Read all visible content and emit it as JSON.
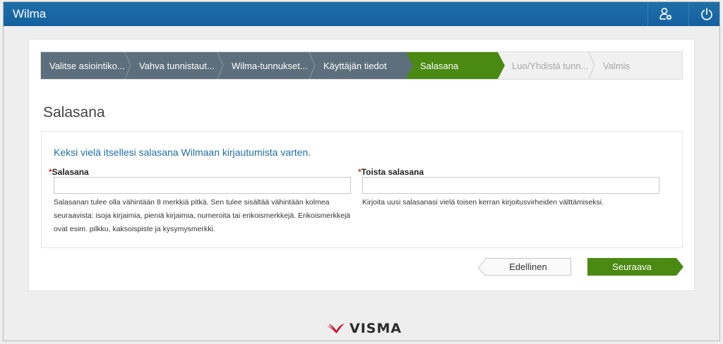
{
  "app": {
    "title": "Wilma"
  },
  "header": {
    "user_icon": "user-settings-icon",
    "power_icon": "power-icon"
  },
  "steps": [
    {
      "label": "Valitse asiointiko...",
      "state": "done"
    },
    {
      "label": "Vahva tunnistaut...",
      "state": "done"
    },
    {
      "label": "Wilma-tunnukset...",
      "state": "done"
    },
    {
      "label": "Käyttäjän tiedot",
      "state": "done"
    },
    {
      "label": "Salasana",
      "state": "active"
    },
    {
      "label": "Luo/Yhdistä tunn...",
      "state": "todo"
    },
    {
      "label": "Valmis",
      "state": "todo"
    }
  ],
  "page": {
    "title": "Salasana"
  },
  "form": {
    "intro": "Keksi vielä itsellesi salasana Wilmaan kirjautumista varten.",
    "required_mark": "*",
    "password": {
      "label": "Salasana",
      "value": "",
      "help_lines": [
        "Salasanan tulee olla vähintään 8 merkkiä pitkä. Sen tulee sisältää vähintään kolmea",
        "seuraavista: isoja kirjaimia, pieniä kirjaimia, numeroita tai erikoismerkkejä. Erikoismerkkejä",
        "ovat esim. pilkku, kaksoispiste ja kysymysmerkki."
      ]
    },
    "repeat": {
      "label": "Toista salasana",
      "value": "",
      "help": "Kirjoita uusi salasanasi vielä toisen kerran kirjoitusvirheiden välttämiseksi."
    }
  },
  "buttons": {
    "previous": "Edellinen",
    "next": "Seuraava"
  },
  "footer": {
    "brand": "VISMA"
  },
  "colors": {
    "topbar": "#1560a0",
    "step_done": "#5d6f7c",
    "step_active": "#4a8a12",
    "intro_text": "#1f6ea8",
    "brand_red": "#c8102e"
  }
}
